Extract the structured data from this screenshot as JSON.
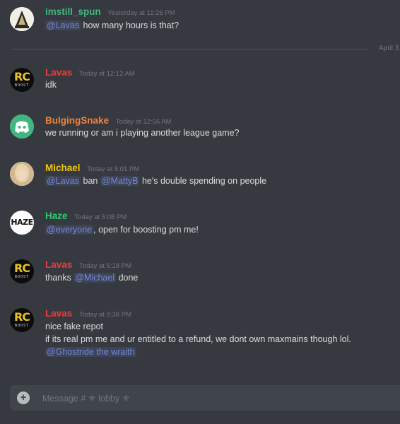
{
  "messages": [
    {
      "author": "imstill_spun",
      "color": "#43b581",
      "timestamp": "Yesterday at 11:26 PM",
      "lines": [
        [
          {
            "mention": "@Lavas"
          },
          {
            "text": "how many  hours is that?"
          }
        ]
      ]
    },
    {
      "author": "Lavas",
      "color": "#e63e3e",
      "timestamp": "Today at 12:12 AM",
      "lines": [
        [
          {
            "text": "idk"
          }
        ]
      ]
    },
    {
      "author": "BulgingSnake",
      "color": "#f0813a",
      "timestamp": "Today at 12:56 AM",
      "lines": [
        [
          {
            "text": "we running or am i playing another league game?"
          }
        ]
      ]
    },
    {
      "author": "Michael",
      "color": "#f1c40f",
      "timestamp": "Today at 5:01 PM",
      "lines": [
        [
          {
            "mention": "@Lavas"
          },
          {
            "text": "ban"
          },
          {
            "mention": "@MattyB"
          },
          {
            "text": "he's double spending on people"
          }
        ]
      ]
    },
    {
      "author": "Haze",
      "color": "#2ecc71",
      "timestamp": "Today at 5:08 PM",
      "lines": [
        [
          {
            "mention": "@everyone"
          },
          {
            "text": ",  open for boosting pm me!"
          }
        ]
      ]
    },
    {
      "author": "Lavas",
      "color": "#e63e3e",
      "timestamp": "Today at 5:18 PM",
      "lines": [
        [
          {
            "text": "thanks"
          },
          {
            "mention": "@Michael"
          },
          {
            "text": "done"
          }
        ]
      ]
    },
    {
      "author": "Lavas",
      "color": "#e63e3e",
      "timestamp": "Today at 9:38 PM",
      "lines": [
        [
          {
            "text": "nice fake repot"
          }
        ],
        [
          {
            "text": "if its real pm me and ur entitled to a refund, we dont own maxmains though lol."
          }
        ],
        [
          {
            "mention": "@Ghostride the wraith"
          }
        ]
      ]
    }
  ],
  "divider_label": "April 3",
  "composer": {
    "placeholder": "Message # ⚜ lobby ⚜"
  },
  "avatars": {
    "rc_text": "RC",
    "rc_sub": "BOOST",
    "haze_text": "HAZE"
  }
}
